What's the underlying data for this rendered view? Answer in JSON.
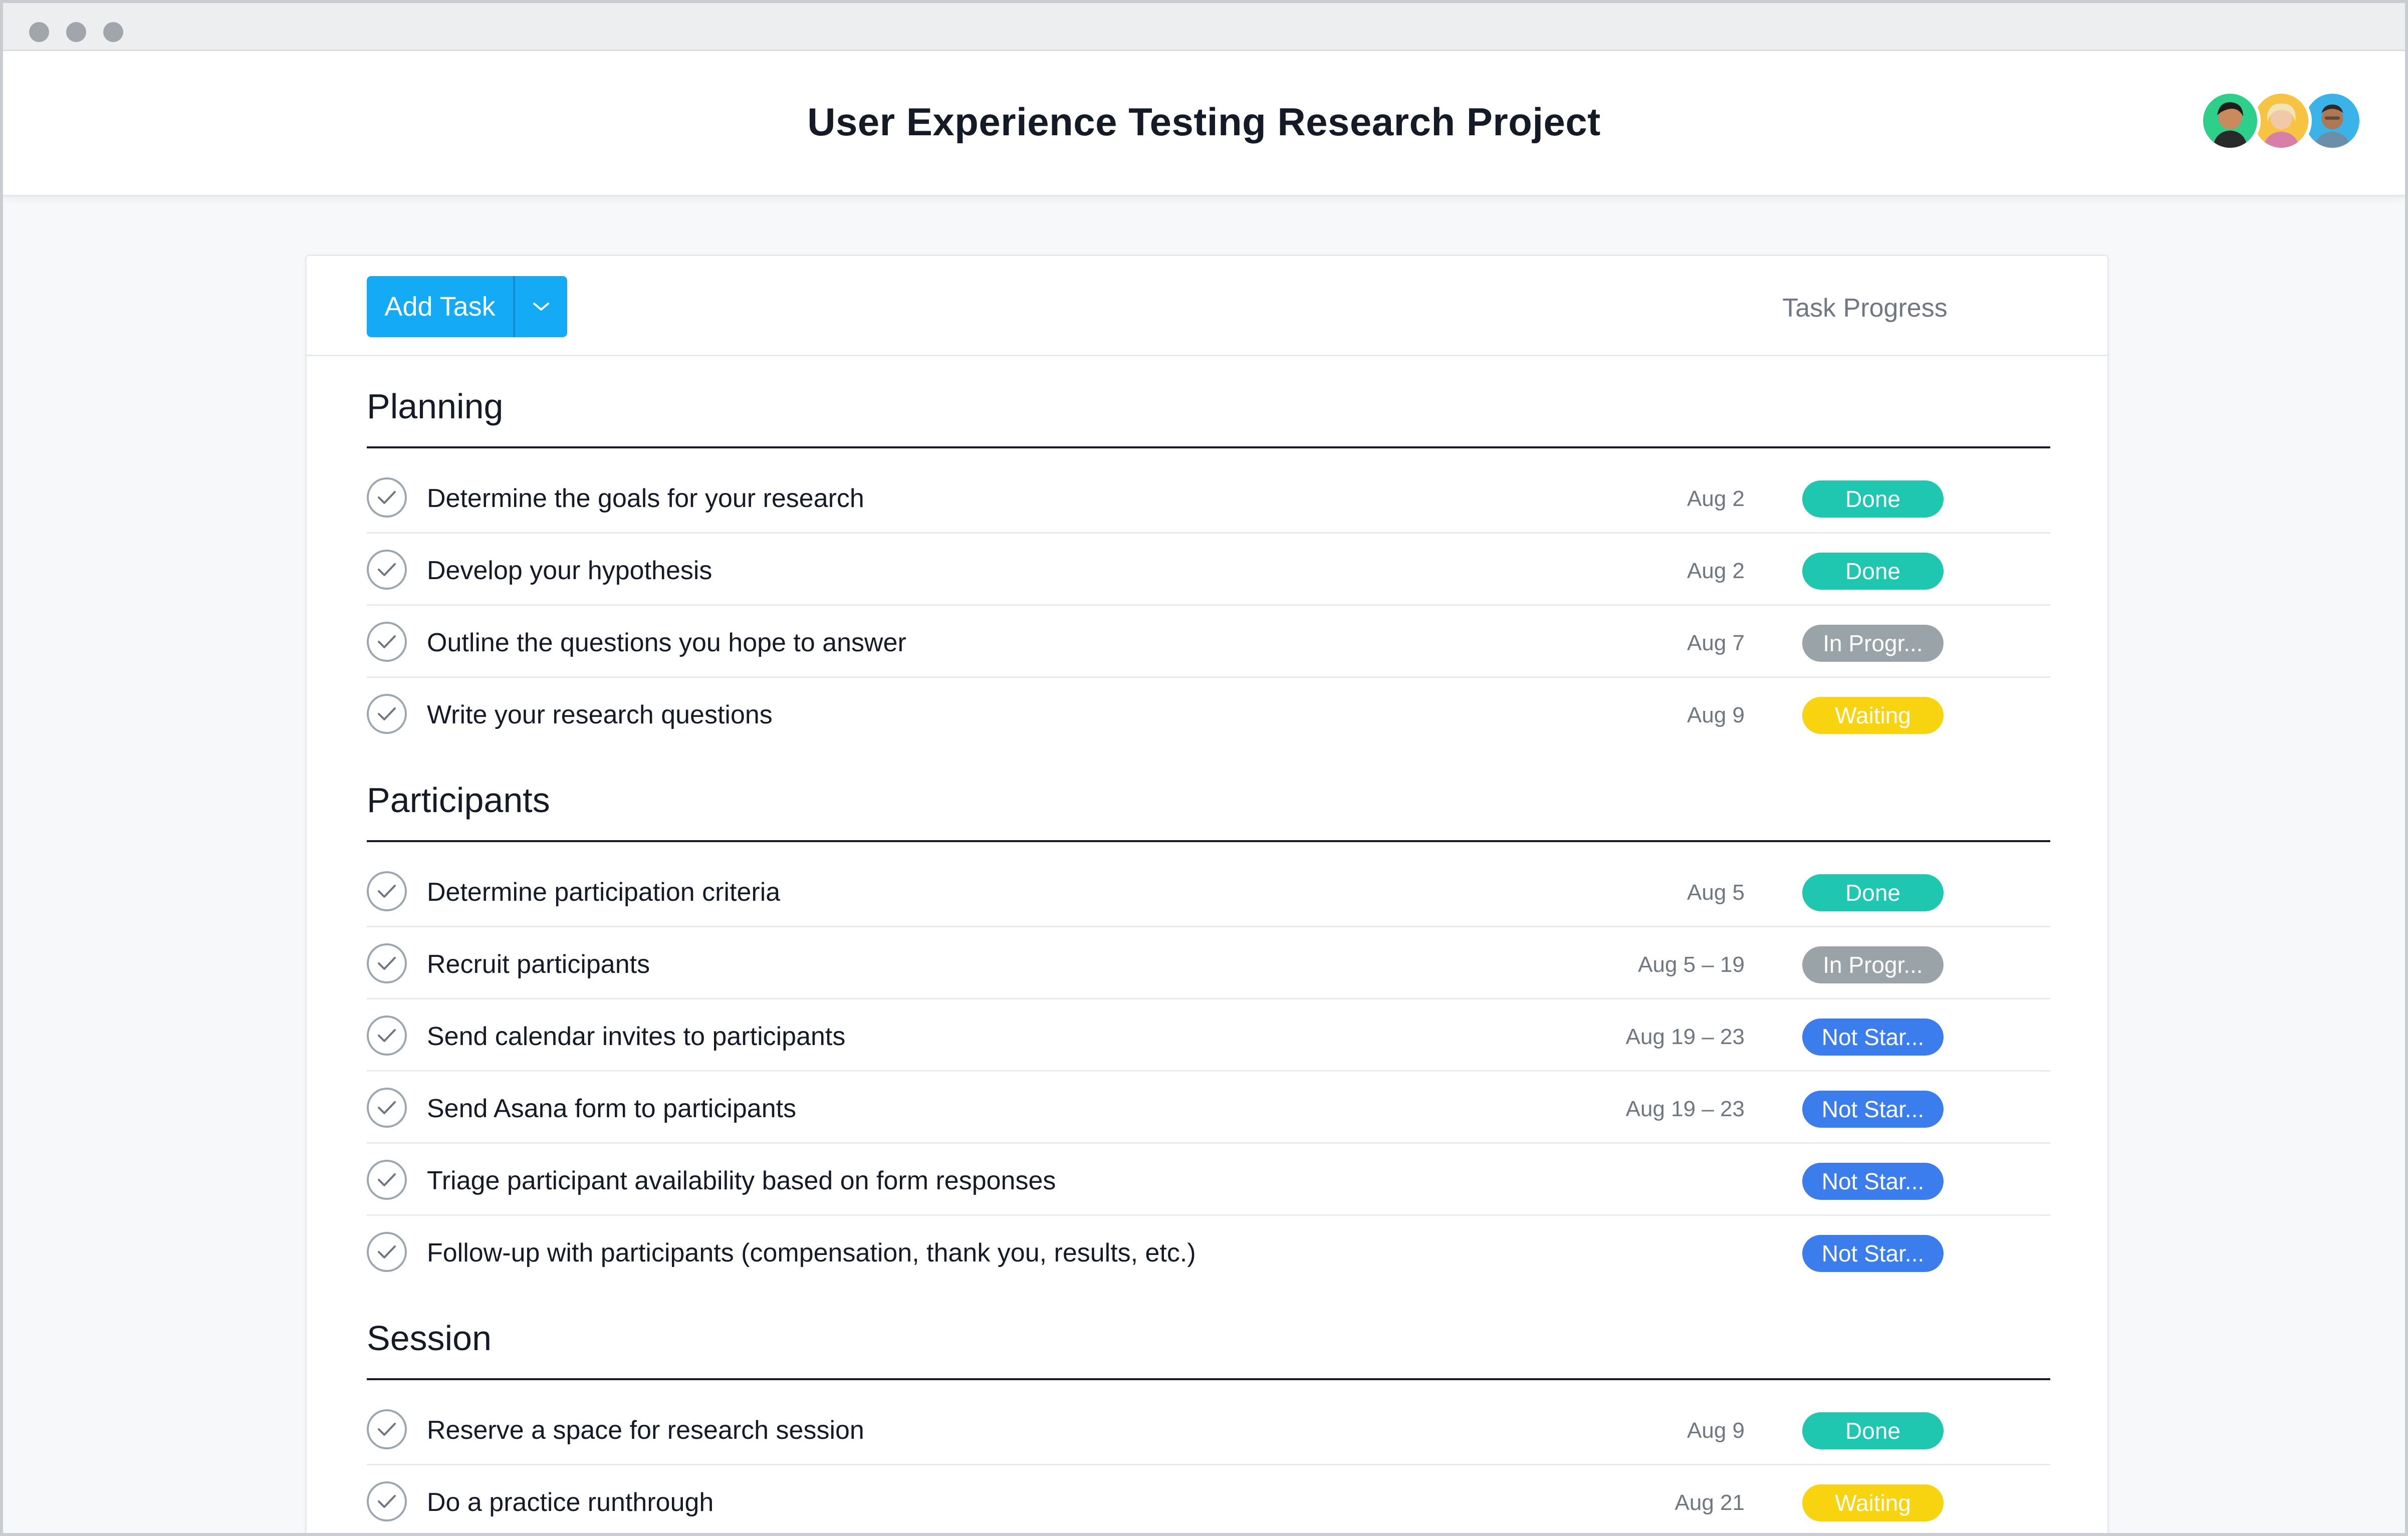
{
  "window": {
    "controls": [
      "close",
      "minimize",
      "maximize"
    ]
  },
  "project": {
    "title": "User Experience Testing Research Project",
    "members": [
      "member-1",
      "member-2",
      "member-3"
    ]
  },
  "toolbar": {
    "add_task_label": "Add Task",
    "column_header": "Task Progress"
  },
  "status_colors": {
    "Done": "#1fc7b1",
    "In Progr...": "#9aa3a8",
    "Waiting": "#f8d30f",
    "Not Star...": "#3b7ded"
  },
  "sections": [
    {
      "title": "Planning",
      "tasks": [
        {
          "name": "Determine the goals for your research",
          "date": "Aug 2",
          "status": "Done"
        },
        {
          "name": "Develop your hypothesis",
          "date": "Aug 2",
          "status": "Done"
        },
        {
          "name": "Outline the questions you hope to answer",
          "date": "Aug 7",
          "status": "In Progr..."
        },
        {
          "name": "Write your research questions",
          "date": "Aug 9",
          "status": "Waiting"
        }
      ]
    },
    {
      "title": "Participants",
      "tasks": [
        {
          "name": "Determine participation criteria",
          "date": "Aug 5",
          "status": "Done"
        },
        {
          "name": "Recruit participants",
          "date": "Aug 5 – 19",
          "status": "In Progr..."
        },
        {
          "name": "Send calendar invites to participants",
          "date": "Aug 19 – 23",
          "status": "Not Star..."
        },
        {
          "name": "Send Asana form to participants",
          "date": "Aug 19 – 23",
          "status": "Not Star..."
        },
        {
          "name": "Triage participant availability based on form responses",
          "date": "",
          "status": "Not Star..."
        },
        {
          "name": "Follow-up with participants (compensation, thank you, results, etc.)",
          "date": "",
          "status": "Not Star..."
        }
      ]
    },
    {
      "title": "Session",
      "tasks": [
        {
          "name": "Reserve a space for research session",
          "date": "Aug 9",
          "status": "Done"
        },
        {
          "name": "Do a practice runthrough",
          "date": "Aug 21",
          "status": "Waiting"
        }
      ]
    }
  ]
}
